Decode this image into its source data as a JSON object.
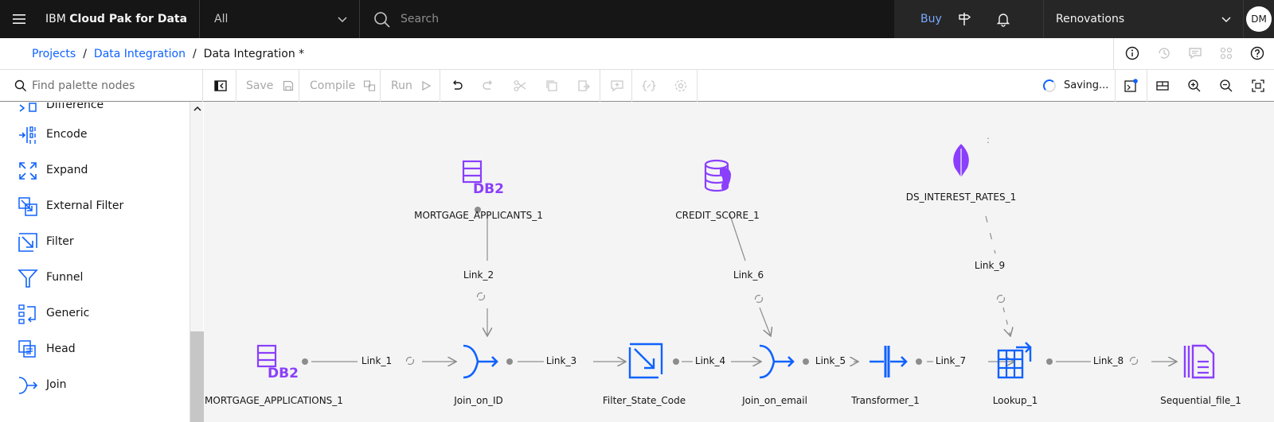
{
  "header": {
    "brand_prefix": "IBM ",
    "brand_name": "Cloud Pak for Data",
    "scope_value": "All",
    "search_placeholder": "Search",
    "buy_label": "Buy",
    "account_name": "Renovations",
    "avatar_initials": "DM"
  },
  "breadcrumb": {
    "items": [
      "Projects",
      "Data Integration"
    ],
    "current": "Data Integration *"
  },
  "toolbar": {
    "palette_search_placeholder": "Find palette nodes",
    "save_label": "Save",
    "compile_label": "Compile",
    "run_label": "Run",
    "status_text": "Saving..."
  },
  "palette": {
    "items": [
      {
        "label": "Difference",
        "icon": "difference-icon"
      },
      {
        "label": "Encode",
        "icon": "encode-icon"
      },
      {
        "label": "Expand",
        "icon": "expand-icon"
      },
      {
        "label": "External Filter",
        "icon": "external-filter-icon"
      },
      {
        "label": "Filter",
        "icon": "filter-icon"
      },
      {
        "label": "Funnel",
        "icon": "funnel-icon"
      },
      {
        "label": "Generic",
        "icon": "generic-icon"
      },
      {
        "label": "Head",
        "icon": "head-icon"
      },
      {
        "label": "Join",
        "icon": "join-icon"
      }
    ]
  },
  "canvas": {
    "nodes": {
      "mortgage_applicants": "MORTGAGE_APPLICANTS_1",
      "credit_score": "CREDIT_SCORE_1",
      "interest_rates": "DS_INTEREST_RATES_1",
      "mortgage_applications": "MORTGAGE_APPLICATIONS_1",
      "join_id": "Join_on_ID",
      "filter_state": "Filter_State_Code",
      "join_email": "Join_on_email",
      "transformer": "Transformer_1",
      "lookup": "Lookup_1",
      "sequential": "Sequential_file_1"
    },
    "links": {
      "link1": "Link_1",
      "link2": "Link_2",
      "link3": "Link_3",
      "link4": "Link_4",
      "link5": "Link_5",
      "link6": "Link_6",
      "link7": "Link_7",
      "link8": "Link_8",
      "link9": "Link_9"
    }
  },
  "colors": {
    "accent_blue": "#0f62fe",
    "node_blue": "#0f62fe",
    "node_purple": "#8a3ffc"
  }
}
